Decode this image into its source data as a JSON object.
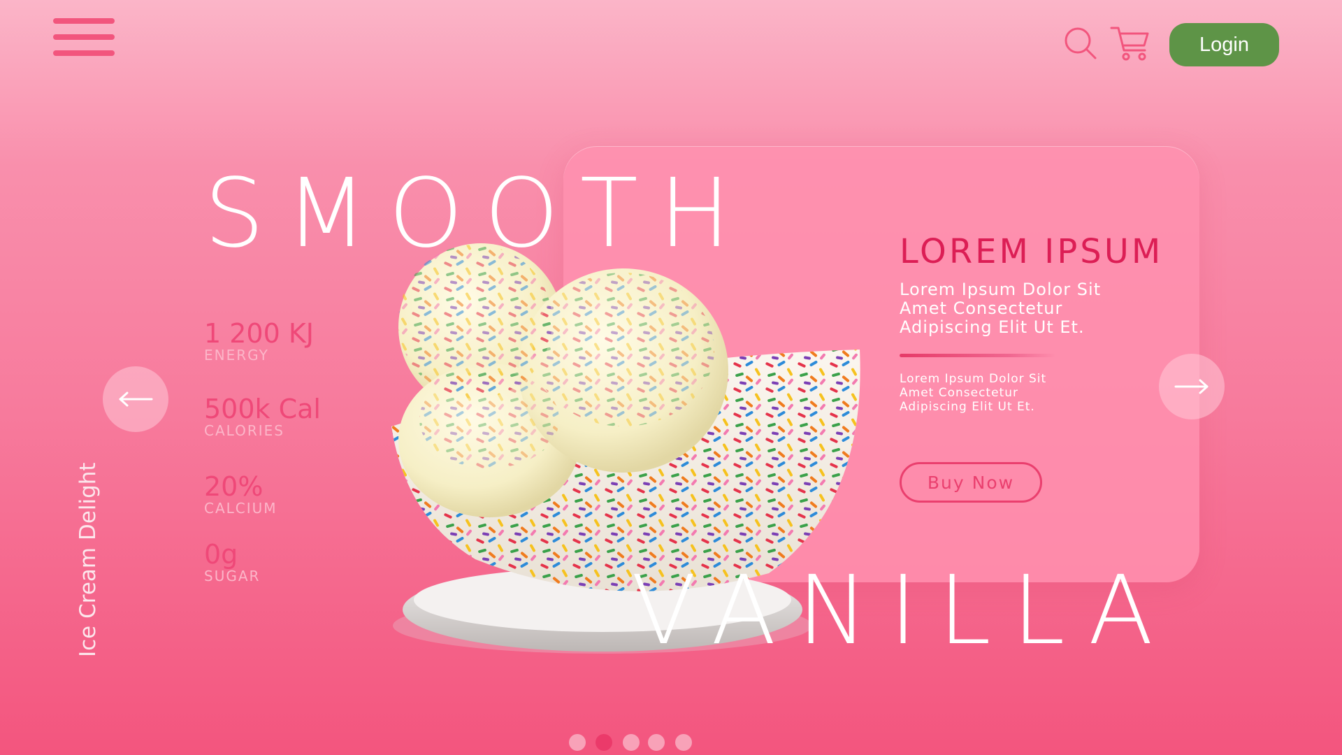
{
  "header": {
    "menu_icon": "hamburger-menu-icon",
    "search_icon": "search-icon",
    "cart_icon": "shopping-cart-icon",
    "login_label": "Login"
  },
  "hero": {
    "title_top": "SMOOTH",
    "title_bottom": "VANILLA",
    "side_label": "Ice Cream Delight"
  },
  "stats": [
    {
      "value": "1 200 KJ",
      "label": "ENERGY"
    },
    {
      "value": "500k Cal",
      "label": "CALORIES"
    },
    {
      "value": "20%",
      "label": "CALCIUM"
    },
    {
      "value": "0g",
      "label": "SUGAR"
    }
  ],
  "info_card": {
    "title": "LOREM IPSUM",
    "subtitle": "Lorem Ipsum Dolor Sit Amet Consectetur Adipiscing Elit Ut Et.",
    "body": "Lorem Ipsum Dolor Sit Amet Consectetur Adipiscing Elit Ut Et.",
    "button_label": "Buy Now"
  },
  "navigation": {
    "prev_icon": "arrow-left-icon",
    "next_icon": "arrow-right-icon"
  },
  "pagination": {
    "count": 5,
    "active_index": 1
  },
  "colors": {
    "accent_pink": "#eb3a6a",
    "login_green": "#5e9447",
    "background_top": "#fbb5c8",
    "background_bottom": "#f3557e"
  }
}
